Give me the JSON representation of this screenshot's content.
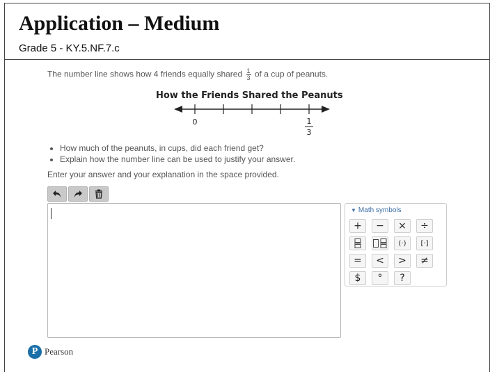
{
  "header": {
    "title": "Application – Medium",
    "subtitle": "Grade 5  - KY.5.NF.7.c"
  },
  "question": {
    "prompt_before": "The number line shows how 4 friends equally shared",
    "fraction": {
      "numerator": "1",
      "denominator": "3"
    },
    "prompt_after": "of a cup of peanuts.",
    "figure_title": "How the Friends Shared the Peanuts",
    "number_line": {
      "start_label": "0",
      "end_label": {
        "numerator": "1",
        "denominator": "3"
      },
      "partitions": 4
    },
    "bullets": [
      "How much of the peanuts, in cups, did each friend get?",
      "Explain how the number line can be used to justify your answer."
    ],
    "instruction": "Enter your answer and your explanation in the space provided."
  },
  "toolbar": {
    "icons": [
      "undo-icon",
      "redo-icon",
      "trash-icon"
    ]
  },
  "answer_box": {
    "value": ""
  },
  "palette": {
    "header": "Math symbols",
    "keys": [
      "+",
      "−",
      "×",
      "÷",
      "",
      "",
      "(·)",
      "[·]",
      "=",
      "<",
      ">",
      "≠",
      "$",
      "°",
      "?"
    ]
  },
  "footer": {
    "brand": "Pearson",
    "logo_letter": "P"
  },
  "colors": {
    "accent": "#3d6ea8",
    "brand": "#1a6fa8"
  }
}
